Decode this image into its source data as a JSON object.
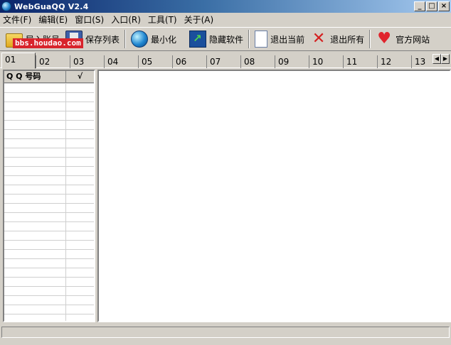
{
  "window": {
    "title": "WebGuaQQ V2.4",
    "buttons": [
      "_",
      "□",
      "×"
    ]
  },
  "menu": [
    {
      "label": "文件(F)"
    },
    {
      "label": "编辑(E)"
    },
    {
      "label": "窗口(S)"
    },
    {
      "label": "入口(R)"
    },
    {
      "label": "工具(T)"
    },
    {
      "label": "关于(A)"
    }
  ],
  "toolbar": {
    "import": "导入账号",
    "save": "保存列表",
    "minimize": "最小化",
    "hide": "隐藏软件",
    "exit_current": "退出当前",
    "exit_all": "退出所有",
    "website": "官方网站"
  },
  "watermark": "bbs.houdao.com",
  "tabs": [
    "01",
    "02",
    "03",
    "04",
    "05",
    "06",
    "07",
    "08",
    "09",
    "10",
    "11",
    "12",
    "13"
  ],
  "list": {
    "columns": [
      "Q Q 号码",
      "√"
    ]
  }
}
